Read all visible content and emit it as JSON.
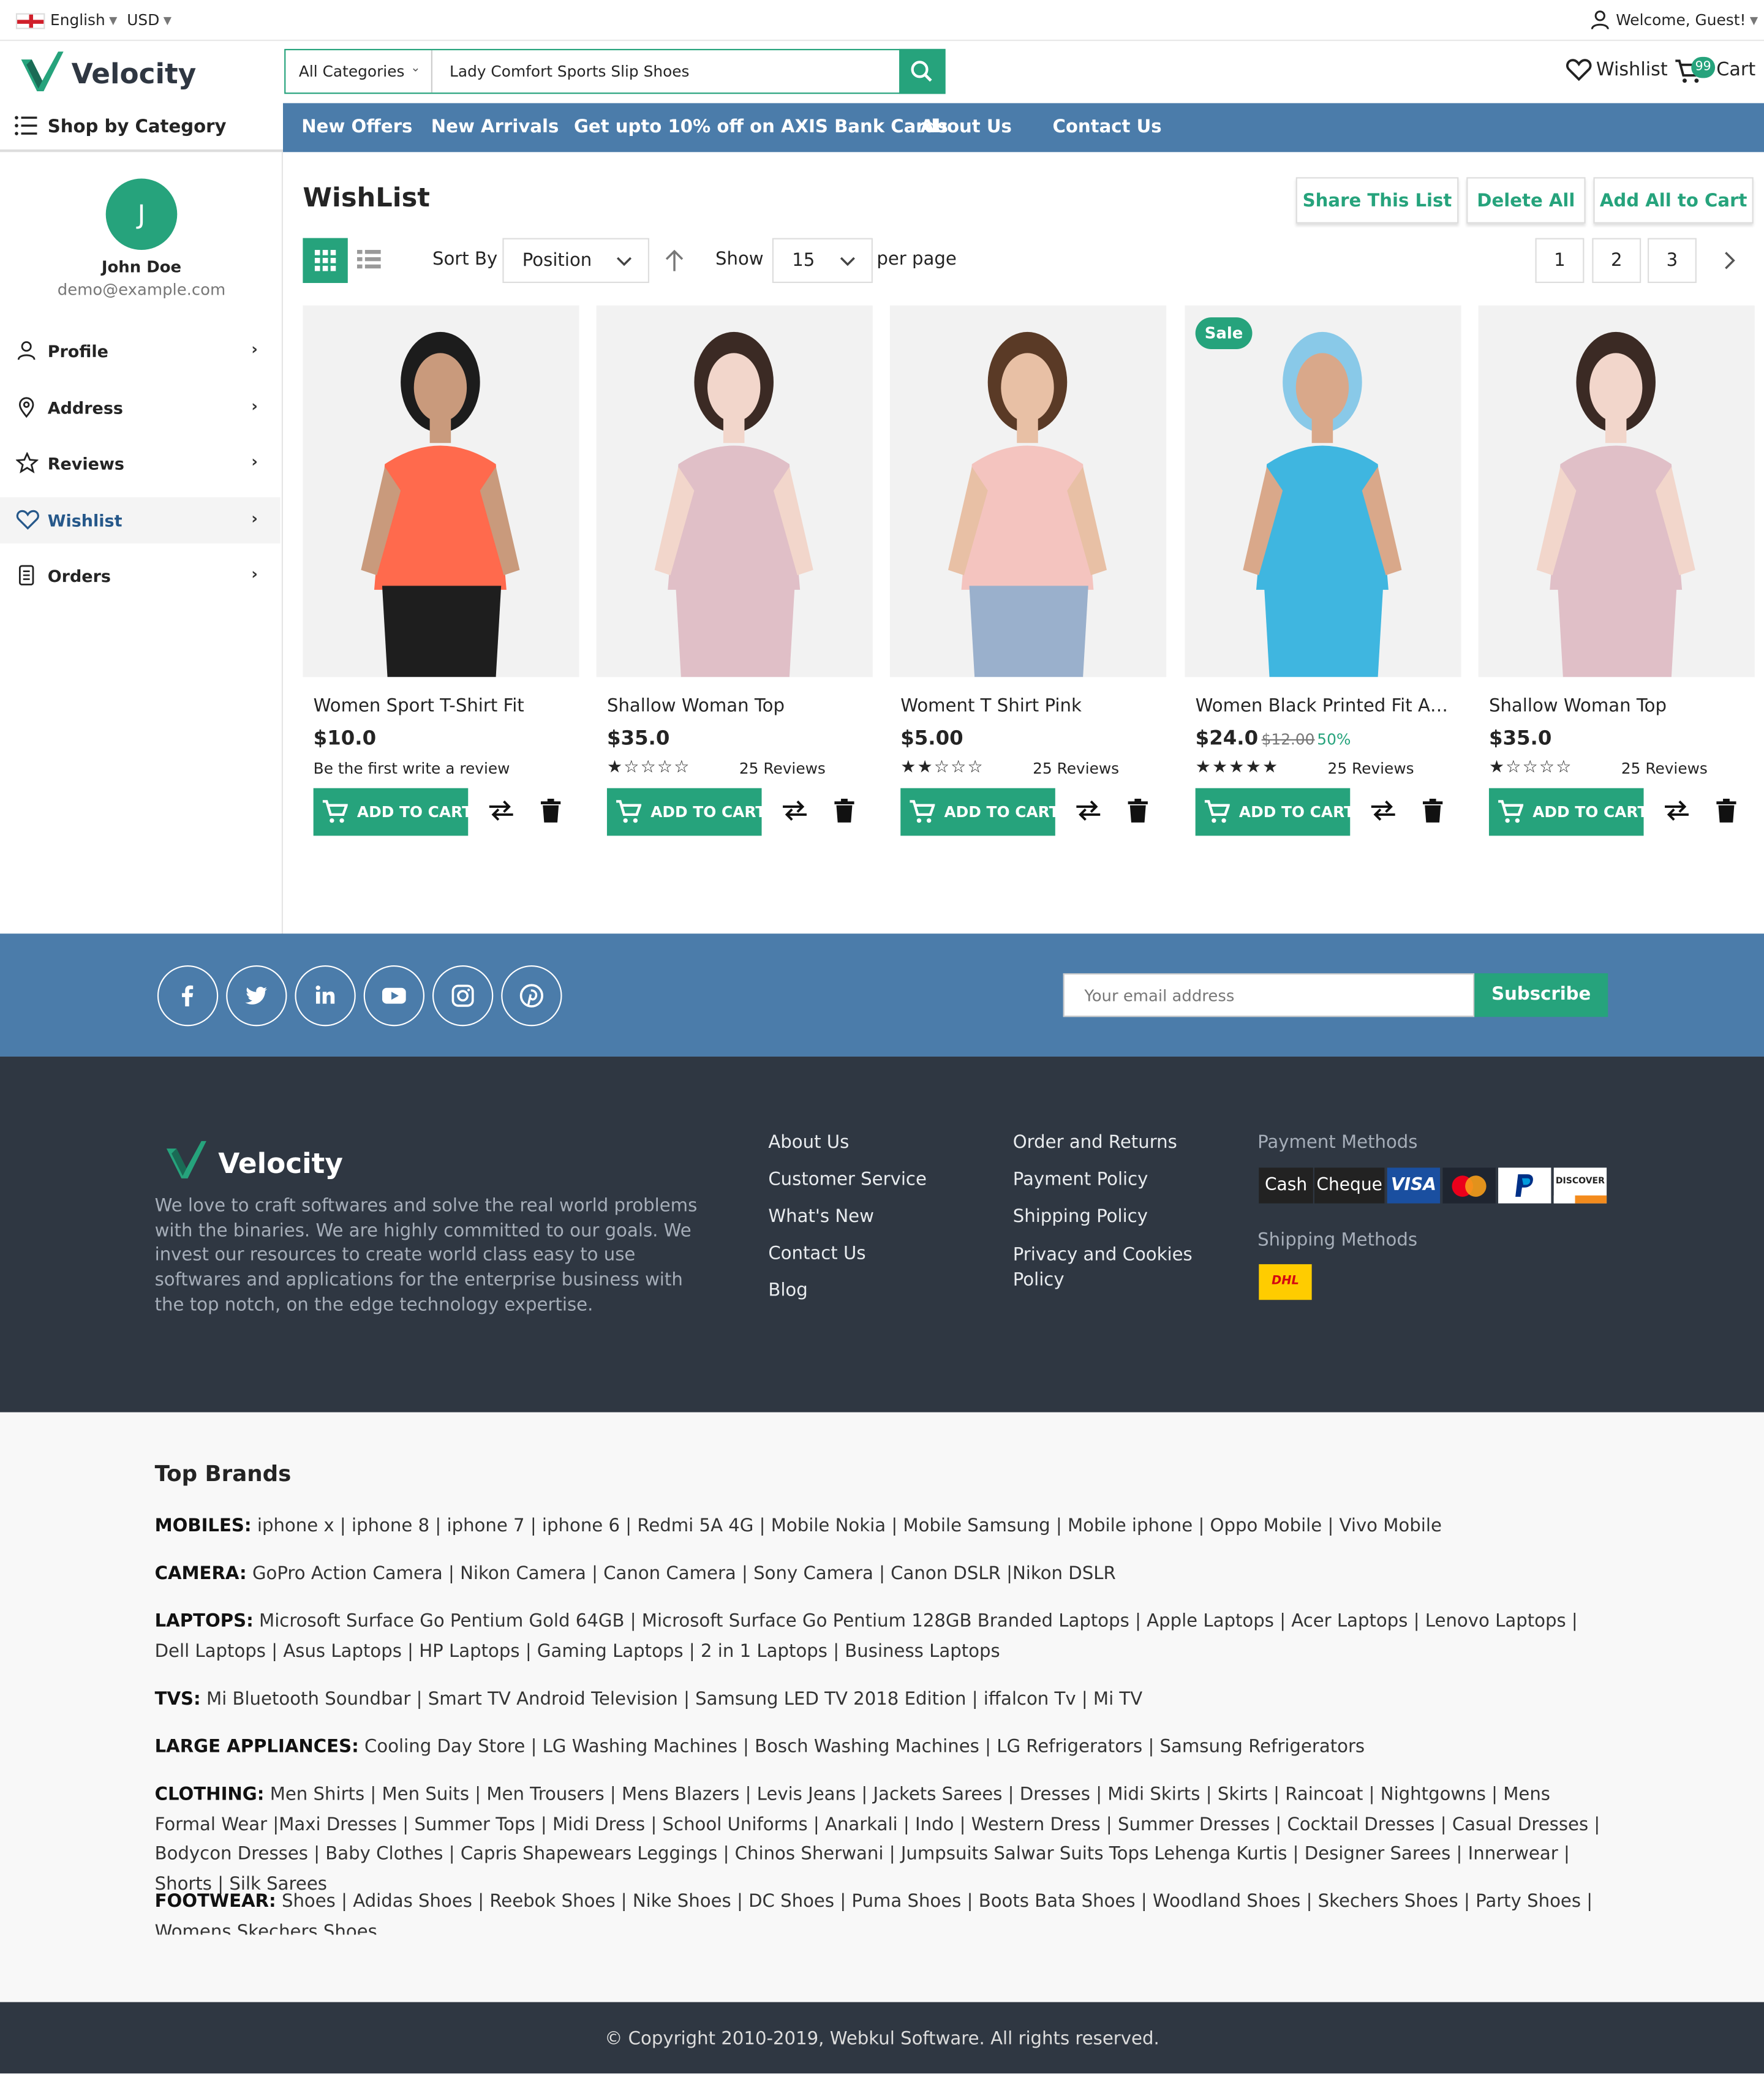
{
  "topbar": {
    "language": "English",
    "currency": "USD",
    "welcome": "Welcome, Guest!"
  },
  "header": {
    "logo": "Velocity",
    "search_category": "All Categories",
    "search_query": "Lady Comfort Sports Slip Shoes",
    "wishlist_label": "Wishlist",
    "cart_label": "Cart",
    "cart_count": "99"
  },
  "nav": {
    "shop_by_category": "Shop by Category",
    "links": [
      "New Offers",
      "New Arrivals",
      "Get upto 10% off on AXIS Bank Cards",
      "About Us",
      "Contact Us"
    ]
  },
  "sidebar": {
    "avatar_initial": "J",
    "name": "John Doe",
    "email": "demo@example.com",
    "items": [
      "Profile",
      "Address",
      "Reviews",
      "Wishlist",
      "Orders"
    ],
    "active": "Wishlist"
  },
  "main": {
    "title": "WishList",
    "actions": [
      "Share This List",
      "Delete All",
      "Add All to Cart"
    ],
    "sort_label": "Sort By",
    "sort_value": "Position",
    "show_label": "Show",
    "show_value": "15",
    "per_page_label": "per page",
    "pages": [
      "1",
      "2",
      "3"
    ]
  },
  "products": [
    {
      "name": "Women Sport T-Shirt Fit",
      "price": "$10.0",
      "review_text": "Be the first write a review",
      "rating": 0,
      "reviews": "",
      "sale": false
    },
    {
      "name": "Shallow Woman Top",
      "price": "$35.0",
      "review_text": "",
      "rating": 1,
      "reviews": "25 Reviews",
      "sale": false
    },
    {
      "name": "Woment T Shirt Pink",
      "price": "$5.00",
      "review_text": "",
      "rating": 2,
      "reviews": "25 Reviews",
      "sale": false
    },
    {
      "name": "Women Black Printed Fit An…",
      "price": "$24.0",
      "old_price": "$12.00",
      "discount": "50%",
      "review_text": "",
      "rating": 5,
      "reviews": "25 Reviews",
      "sale": true,
      "sale_label": "Sale"
    },
    {
      "name": "Shallow Woman Top",
      "price": "$35.0",
      "review_text": "",
      "rating": 1,
      "reviews": "25 Reviews",
      "sale": false
    }
  ],
  "add_to_cart_label": "ADD TO CART",
  "newsletter": {
    "placeholder": "Your email address",
    "button": "Subscribe"
  },
  "social_icons": [
    "facebook-icon",
    "twitter-icon",
    "linkedin-icon",
    "youtube-icon",
    "instagram-icon",
    "pinterest-icon"
  ],
  "footer": {
    "logo": "Velocity",
    "description": "We love to craft softwares and solve the real world problems with the binaries. We are highly committed to our goals. We invest our resources to create world class easy to use softwares and applications for the enterprise business with the top notch, on the edge technology expertise.",
    "col1": [
      "About Us",
      "Customer Service",
      "What's New",
      "Contact Us",
      "Blog"
    ],
    "col2": [
      "Order and Returns",
      "Payment Policy",
      "Shipping Policy",
      "Privacy and Cookies Policy"
    ],
    "payment_heading": "Payment Methods",
    "payment_methods": [
      "Cash",
      "Cheque",
      "VISA",
      "MasterCard",
      "PayPal",
      "DISCOVER"
    ],
    "shipping_heading": "Shipping Methods",
    "shipping_methods": [
      "DHL"
    ]
  },
  "brands": {
    "heading": "Top Brands",
    "rows": [
      {
        "label": "MOBILES:",
        "text": "iphone x | iphone 8 | iphone 7 | iphone 6 | Redmi 5A 4G | Mobile Nokia | Mobile Samsung | Mobile iphone | Oppo Mobile | Vivo Mobile"
      },
      {
        "label": "CAMERA:",
        "text": "GoPro Action Camera | Nikon Camera | Canon Camera | Sony Camera | Canon DSLR |Nikon DSLR"
      },
      {
        "label": "LAPTOPS:",
        "text": "Microsoft Surface Go Pentium Gold 64GB | Microsoft Surface Go Pentium 128GB Branded Laptops | Apple Laptops | Acer Laptops | Lenovo Laptops | Dell Laptops | Asus Laptops | HP Laptops | Gaming Laptops | 2 in 1 Laptops | Business Laptops"
      },
      {
        "label": "TVS:",
        "text": "Mi Bluetooth Soundbar | Smart TV Android Television | Samsung LED TV 2018 Edition | iffalcon Tv | Mi TV"
      },
      {
        "label": "LARGE APPLIANCES:",
        "text": "Cooling Day Store | LG Washing Machines | Bosch Washing Machines | LG Refrigerators | Samsung Refrigerators"
      },
      {
        "label": "CLOTHING:",
        "text": "Men Shirts | Men Suits | Men Trousers | Mens Blazers | Levis Jeans | Jackets Sarees | Dresses | Midi Skirts | Skirts | Raincoat | Nightgowns | Mens Formal Wear |Maxi Dresses | Summer Tops | Midi Dress | School Uniforms | Anarkali | Indo | Western Dress | Summer Dresses | Cocktail Dresses | Casual Dresses | Bodycon Dresses | Baby Clothes | Capris Shapewears Leggings | Chinos Sherwani | Jumpsuits Salwar Suits Tops Lehenga Kurtis | Designer Sarees | Innerwear | Shorts | Silk Sarees"
      },
      {
        "label": "FOOTWEAR:",
        "text": "Shoes | Adidas Shoes | Reebok Shoes | Nike Shoes | DC Shoes | Puma Shoes | Boots Bata Shoes | Woodland Shoes | Skechers Shoes | Party Shoes | Womens Skechers Shoes"
      }
    ]
  },
  "copyright": "© Copyright 2010-2019, Webkul Software. All rights reserved.",
  "colors": {
    "accent": "#26a37c",
    "nav_blue": "#4b7caa",
    "footer_dark": "#2f3742"
  }
}
